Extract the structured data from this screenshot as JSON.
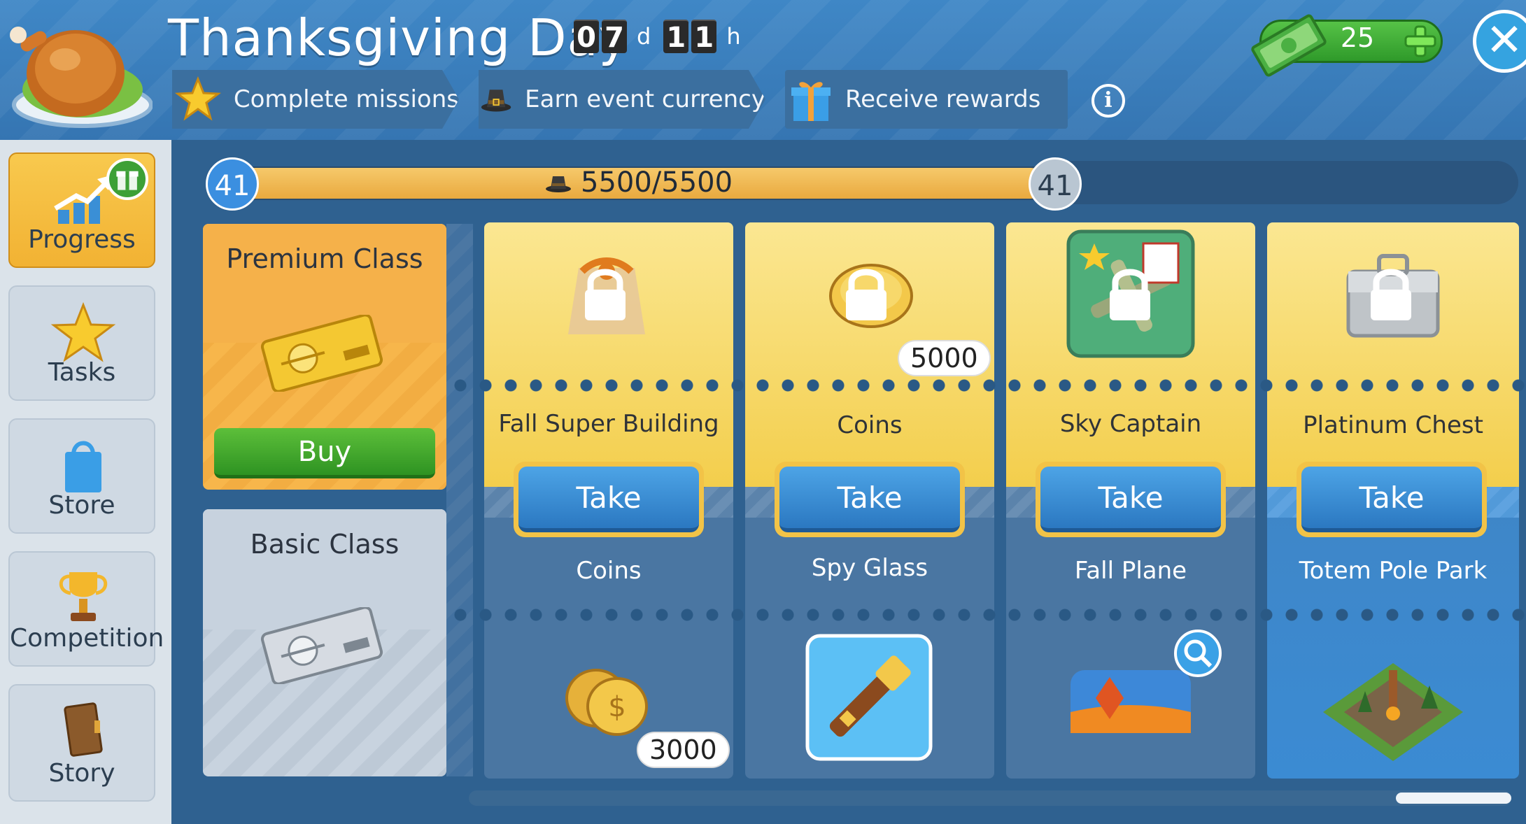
{
  "header": {
    "title": "Thanksgiving Day",
    "timer": {
      "days_digits": [
        "0",
        "7"
      ],
      "days_unit": "d",
      "hours_digits": [
        "1",
        "1"
      ],
      "hours_unit": "h"
    },
    "steps": [
      {
        "label": "Complete missions",
        "icon": "star-icon"
      },
      {
        "label": "Earn event currency",
        "icon": "pilgrim-hat-icon"
      },
      {
        "label": "Receive rewards",
        "icon": "gift-box-icon"
      }
    ],
    "info_label": "i",
    "cash": "25",
    "close_label": "✕"
  },
  "sidebar": {
    "items": [
      {
        "label": "Progress",
        "icon": "progress-chart-icon",
        "active": true
      },
      {
        "label": "Tasks",
        "icon": "star-icon"
      },
      {
        "label": "Store",
        "icon": "shopping-bag-icon"
      },
      {
        "label": "Competition",
        "icon": "trophy-icon"
      },
      {
        "label": "Story",
        "icon": "book-icon"
      }
    ]
  },
  "progress": {
    "level_left": "41",
    "level_right": "41",
    "value": "5500/5500",
    "fraction": 1.0
  },
  "classes": {
    "premium": {
      "title": "Premium Class",
      "buy_label": "Buy"
    },
    "basic": {
      "title": "Basic Class"
    }
  },
  "rewards": [
    {
      "premium_name": "Fall Super Building",
      "premium_badge": "",
      "take_label": "Take",
      "basic_name": "Coins",
      "basic_badge": "3000"
    },
    {
      "premium_name": "Coins",
      "premium_badge": "5000",
      "take_label": "Take",
      "basic_name": "Spy Glass",
      "basic_badge": ""
    },
    {
      "premium_name": "Sky Captain",
      "premium_badge": "",
      "take_label": "Take",
      "basic_name": "Fall Plane",
      "basic_badge": ""
    },
    {
      "premium_name": "Platinum Chest",
      "premium_badge": "",
      "take_label": "Take",
      "basic_name": "Totem Pole Park",
      "basic_badge": ""
    }
  ]
}
